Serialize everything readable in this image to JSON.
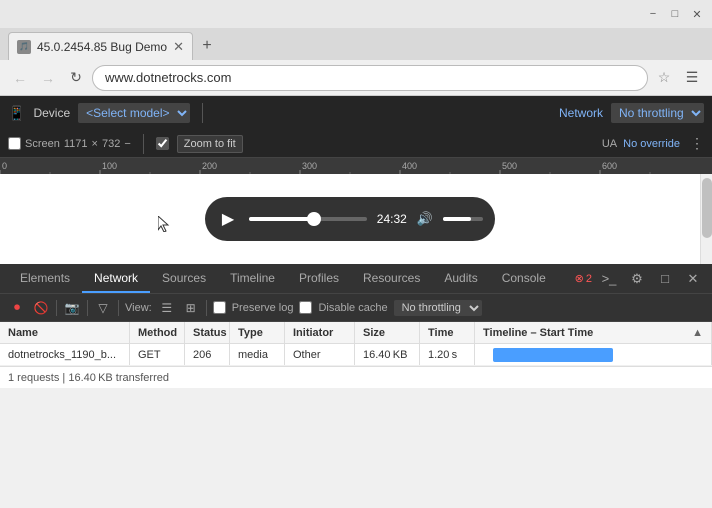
{
  "browser": {
    "title": "45.0.2454.85 Bug Demo",
    "url": "www.dotnetrocks.com",
    "minimize": "−",
    "maximize": "□",
    "close": "✕",
    "new_tab": "+",
    "back": "←",
    "forward": "→",
    "reload": "↻"
  },
  "devtools_top": {
    "device_label": "Device",
    "select_model_placeholder": "<Select model>",
    "network_label": "Network",
    "throttle_option": "No throttling"
  },
  "devtools_secondary": {
    "screen_label": "Screen",
    "width": "1171",
    "cross": "×",
    "height": "732",
    "minus": "−",
    "zoom_label": "Zoom to fit",
    "ua_label": "UA",
    "override_label": "No override",
    "more": "⋮"
  },
  "ruler": {
    "marks": [
      "0",
      "100",
      "200",
      "300",
      "400",
      "500",
      "600"
    ]
  },
  "audio_player": {
    "time": "24:32"
  },
  "devtools_tabs": {
    "tabs": [
      {
        "id": "elements",
        "label": "Elements"
      },
      {
        "id": "network",
        "label": "Network",
        "active": true
      },
      {
        "id": "sources",
        "label": "Sources"
      },
      {
        "id": "timeline",
        "label": "Timeline"
      },
      {
        "id": "profiles",
        "label": "Profiles"
      },
      {
        "id": "resources",
        "label": "Resources"
      },
      {
        "id": "audits",
        "label": "Audits"
      },
      {
        "id": "console",
        "label": "Console"
      }
    ],
    "error_count": "2",
    "icons": [
      "⚙",
      "□",
      "✕"
    ]
  },
  "network_toolbar": {
    "view_label": "View:",
    "preserve_log": "Preserve log",
    "disable_cache": "Disable cache",
    "throttle": "No throttling"
  },
  "network_table": {
    "columns": [
      "Name",
      "Method",
      "Status",
      "Type",
      "Initiator",
      "Size",
      "Time",
      "Timeline – Start Time"
    ],
    "rows": [
      {
        "name": "dotnetrocks_1190_b...",
        "method": "GET",
        "status": "206",
        "type": "media",
        "initiator": "Other",
        "size": "16.40 KB",
        "time": "1.20 s",
        "has_bar": true
      }
    ]
  },
  "status_bar": {
    "text": "1 requests  |  16.40 KB transferred"
  }
}
